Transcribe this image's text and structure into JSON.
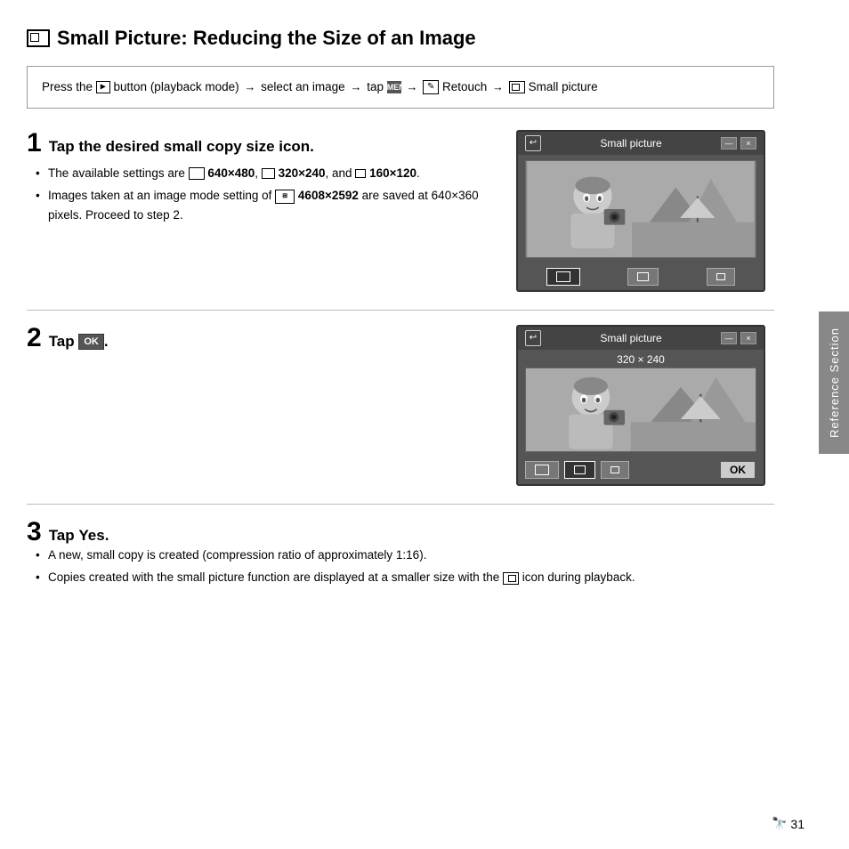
{
  "page": {
    "title": "Small Picture: Reducing the Size of an Image",
    "instruction": {
      "text": "Press the  button (playback mode) → select an image → tap  →  Retouch →  Small picture"
    },
    "steps": [
      {
        "number": "1",
        "title": "Tap the desired small copy size icon.",
        "bullets": [
          "The available settings are  640×480,  320×240, and  160×120.",
          "Images taken at an image mode setting of  4608×2592 are saved at 640×360 pixels. Proceed to step 2."
        ],
        "screen_title": "Small picture",
        "screen_size_label": ""
      },
      {
        "number": "2",
        "title": "Tap OK.",
        "screen_title": "Small picture",
        "screen_size_label": "320 × 240"
      },
      {
        "number": "3",
        "title": "Tap Yes.",
        "bullets": [
          "A new, small copy is created (compression ratio of approximately 1:16).",
          "Copies created with the small picture function are displayed at a smaller size with the  icon during playback."
        ]
      }
    ],
    "sidebar_label": "Reference Section",
    "page_number": "31"
  }
}
